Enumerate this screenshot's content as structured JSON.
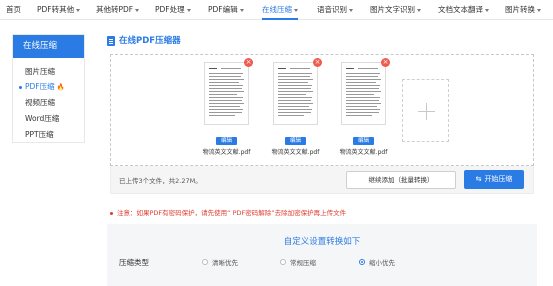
{
  "nav": {
    "items": [
      {
        "label": "首页",
        "caret": false,
        "active": false
      },
      {
        "label": "PDF转其他",
        "caret": true,
        "active": false
      },
      {
        "label": "其他转PDF",
        "caret": true,
        "active": false
      },
      {
        "label": "PDF处理",
        "caret": true,
        "active": false
      },
      {
        "label": "PDF编辑",
        "caret": true,
        "active": false
      },
      {
        "label": "在线压缩",
        "caret": true,
        "active": true
      },
      {
        "label": "语音识别",
        "caret": true,
        "active": false
      },
      {
        "label": "图片文字识别",
        "caret": true,
        "active": false
      },
      {
        "label": "文档文本翻译",
        "caret": true,
        "active": false
      },
      {
        "label": "图片转换",
        "caret": true,
        "active": false
      }
    ]
  },
  "sidebar": {
    "header": "在线压缩",
    "items": [
      {
        "label": "图片压缩",
        "active": false
      },
      {
        "label": "PDF压缩",
        "active": true,
        "hot": true
      },
      {
        "label": "视频压缩",
        "active": false
      },
      {
        "label": "Word压缩",
        "active": false
      },
      {
        "label": "PPT压缩",
        "active": false
      }
    ],
    "hot_icon": "fire-icon"
  },
  "main": {
    "title": "在线PDF压缩器",
    "title_icon": "document-icon"
  },
  "files": [
    {
      "name": "物流英文文献.pdf",
      "edit_label": "编辑",
      "delete_icon": "close-icon"
    },
    {
      "name": "物流英文文献.pdf",
      "edit_label": "编辑",
      "delete_icon": "close-icon"
    },
    {
      "name": "物流英文文献.pdf",
      "edit_label": "编辑",
      "delete_icon": "close-icon"
    }
  ],
  "add_file_icon": "plus-icon",
  "status": {
    "text": "已上传3个文件，共2.27M。",
    "batch_button": "继续添加（批量转换）",
    "start_button": "开始压缩",
    "start_icon": "swap-icon"
  },
  "warning": {
    "text": "注意：如果PDF有密码保护，请先使用“ PDF密码解除”去除加密保护再上传文件"
  },
  "settings": {
    "title": "自定义设置转换如下",
    "option_label": "压缩类型",
    "options": [
      {
        "label": "清晰优先",
        "selected": false
      },
      {
        "label": "常规压缩",
        "selected": false
      },
      {
        "label": "缩小优先",
        "selected": true
      }
    ]
  },
  "colors": {
    "accent": "#2a7be4",
    "danger": "#e03c31",
    "delete": "#f05a4f",
    "hot": "#ff6b2b"
  }
}
